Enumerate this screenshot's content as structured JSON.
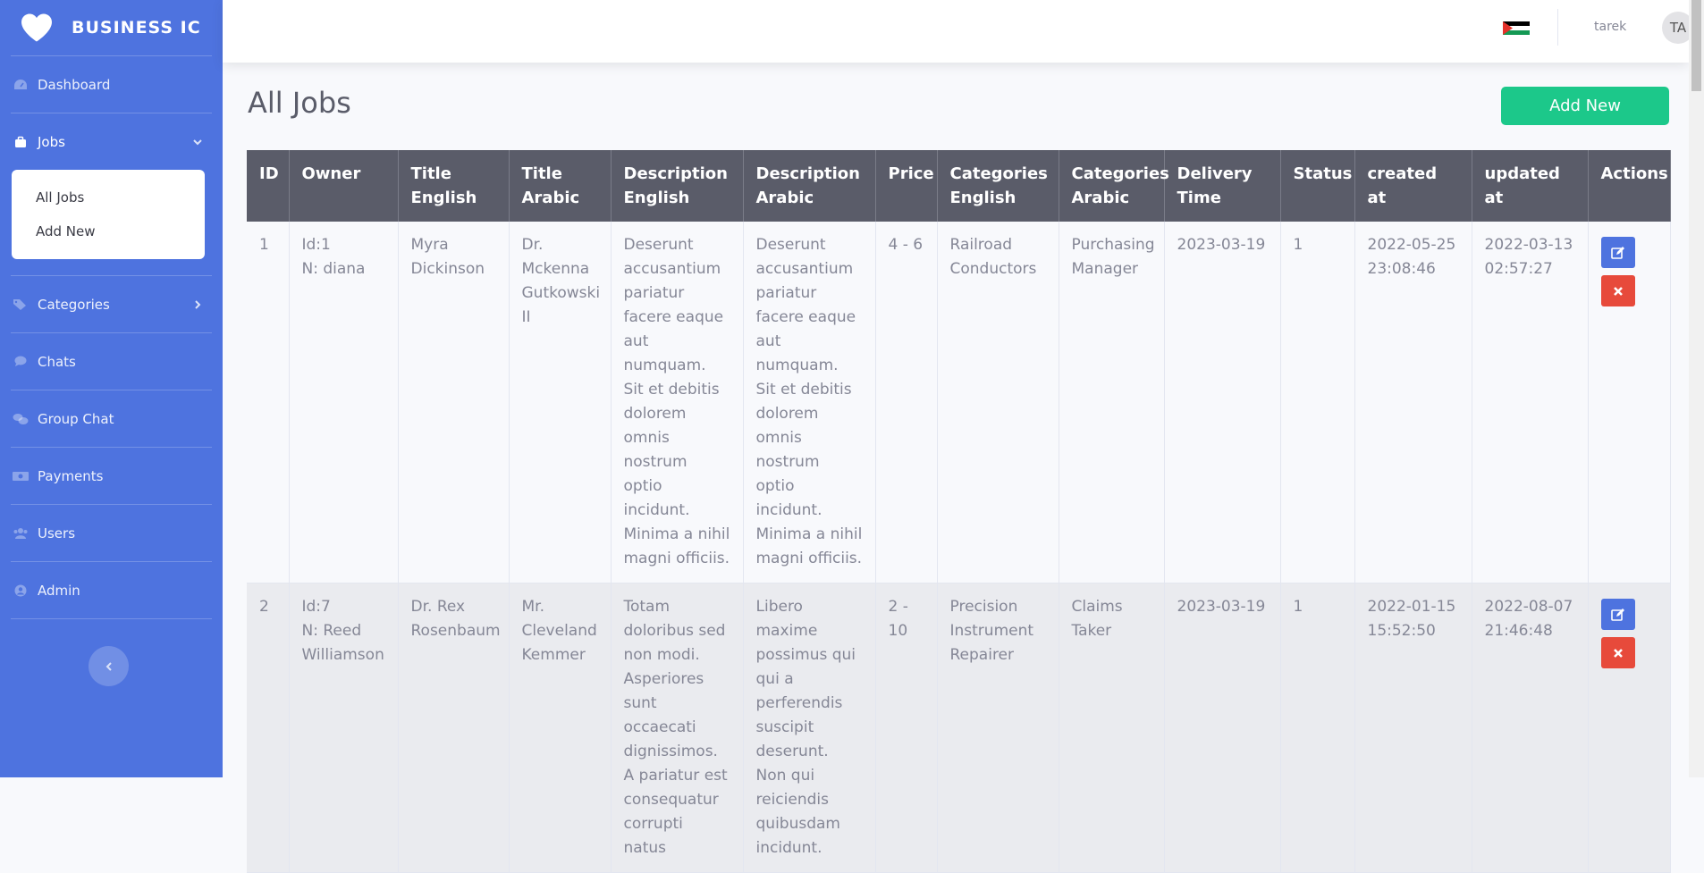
{
  "brand": {
    "name": "BUSINESS IC"
  },
  "sidebar": {
    "items": [
      {
        "label": "Dashboard",
        "icon": "tachometer-icon"
      },
      {
        "label": "Jobs",
        "icon": "briefcase-icon",
        "expanded": true
      },
      {
        "label": "Categories",
        "icon": "tags-icon"
      },
      {
        "label": "Chats",
        "icon": "comment-icon"
      },
      {
        "label": "Group Chat",
        "icon": "comments-icon"
      },
      {
        "label": "Payments",
        "icon": "money-bill-icon"
      },
      {
        "label": "Users",
        "icon": "users-icon"
      },
      {
        "label": "Admin",
        "icon": "user-circle-icon"
      }
    ],
    "jobs_submenu": [
      "All Jobs",
      "Add New"
    ]
  },
  "topbar": {
    "username": "tarek",
    "avatar_initials": "TA"
  },
  "page": {
    "title": "All Jobs",
    "add_button": "Add New"
  },
  "table": {
    "headers": [
      "ID",
      "Owner",
      "Title English",
      "Title Arabic",
      "Description English",
      "Description Arabic",
      "Price",
      "Categories English",
      "Categories Arabic",
      "Delivery Time",
      "Status",
      "created at",
      "updated at",
      "Actions"
    ],
    "rows": [
      {
        "id": "1",
        "owner_id": "Id:1",
        "owner_name": "N: diana",
        "title_en": "Myra Dickinson",
        "title_ar": "Dr. Mckenna Gutkowski II",
        "desc_en": "Deserunt accusantium pariatur facere eaque aut numquam. Sit et debitis dolorem omnis nostrum optio incidunt. Minima a nihil magni officiis.",
        "desc_ar": "Deserunt accusantium pariatur facere eaque aut numquam. Sit et debitis dolorem omnis nostrum optio incidunt. Minima a nihil magni officiis.",
        "price": "4 - 6",
        "cat_en": "Railroad Conductors",
        "cat_ar": "Purchasing Manager",
        "delivery": "2023-03-19",
        "status": "1",
        "created": "2022-05-25 23:08:46",
        "updated": "2022-03-13 02:57:27"
      },
      {
        "id": "2",
        "owner_id": "Id:7",
        "owner_name": "N: Reed Williamson",
        "title_en": "Dr. Rex Rosenbaum",
        "title_ar": "Mr. Cleveland Kemmer",
        "desc_en": "Totam doloribus sed non modi. Asperiores sunt occaecati dignissimos. A pariatur est consequatur corrupti natus",
        "desc_ar": "Libero maxime possimus qui qui a perferendis suscipit deserunt. Non qui reiciendis quibusdam incidunt.",
        "price": "2 - 10",
        "cat_en": "Precision Instrument Repairer",
        "cat_ar": "Claims Taker",
        "delivery": "2023-03-19",
        "status": "1",
        "created": "2022-01-15 15:52:50",
        "updated": "2022-08-07 21:46:48"
      }
    ]
  },
  "colors": {
    "sidebar": "#4e73df",
    "success": "#1cc88a",
    "danger": "#e74a3b",
    "table_header": "#5a5c69"
  }
}
